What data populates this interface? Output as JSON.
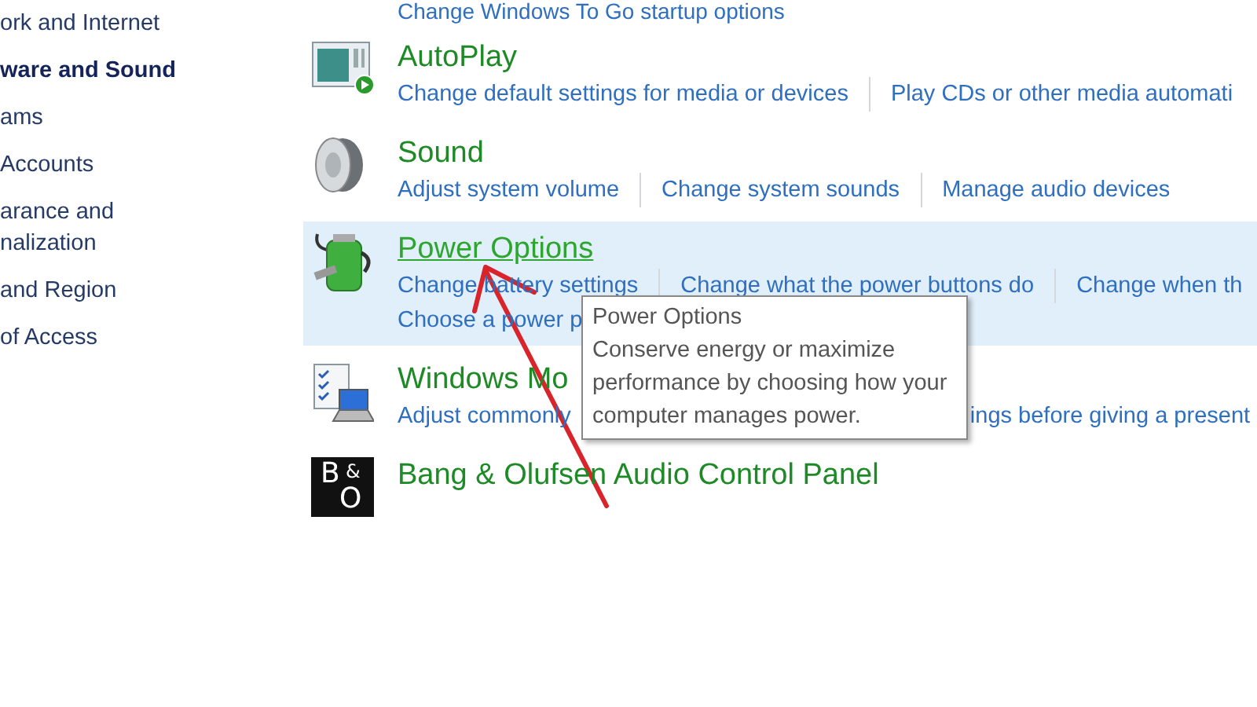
{
  "sidebar": {
    "items": [
      {
        "label": "ork and Internet",
        "selected": false
      },
      {
        "label": "ware and Sound",
        "selected": true
      },
      {
        "label": "ams",
        "selected": false
      },
      {
        "label": "Accounts",
        "selected": false
      },
      {
        "label": "arance and\nnalization",
        "selected": false
      },
      {
        "label": "and Region",
        "selected": false
      },
      {
        "label": "of Access",
        "selected": false
      }
    ]
  },
  "top_link": "Change Windows To Go startup options",
  "categories": [
    {
      "kind": "autoplay",
      "title": "AutoPlay",
      "hovered": false,
      "links": [
        [
          "Change default settings for media or devices",
          "Play CDs or other media automati"
        ]
      ]
    },
    {
      "kind": "sound",
      "title": "Sound",
      "hovered": false,
      "links": [
        [
          "Adjust system volume",
          "Change system sounds",
          "Manage audio devices"
        ]
      ]
    },
    {
      "kind": "power",
      "title": "Power Options",
      "hovered": true,
      "links": [
        [
          "Change battery settings",
          "Change what the power buttons do",
          "Change when th"
        ],
        [
          "Choose a power p"
        ]
      ]
    },
    {
      "kind": "mobility",
      "title": "Windows Mo",
      "hovered": false,
      "links": [
        [
          "Adjust commonly",
          "ings before giving a present"
        ]
      ]
    },
    {
      "kind": "logo",
      "title": "Bang & Olufsen Audio Control Panel",
      "hovered": false,
      "logo_text": [
        "B",
        "&",
        "O"
      ]
    }
  ],
  "tooltip": {
    "title": "Power Options",
    "text": "Conserve energy or maximize performance by choosing how your computer manages power."
  }
}
